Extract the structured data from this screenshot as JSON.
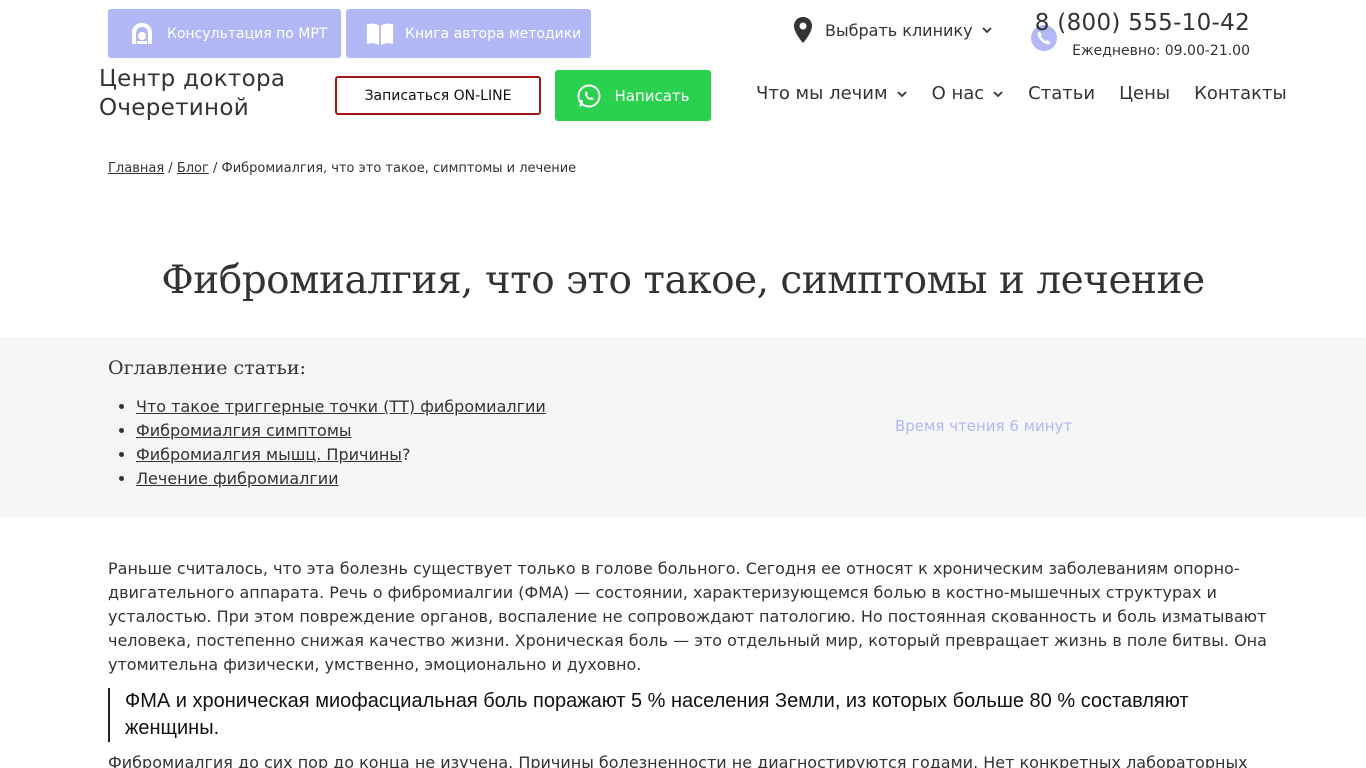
{
  "topbar": {
    "mri_label": "Консультация по МРТ",
    "book_label": "Книга автора методики",
    "clinic_label": "Выбрать клинику",
    "phone": "8 (800) 555-10-42",
    "hours": "Ежедневно: 09.00-21.00"
  },
  "header": {
    "logo_line1": "Центр доктора",
    "logo_line2": "Очеретиной",
    "online_label": "Записаться ON-LINE",
    "write_label": "Написать"
  },
  "nav": {
    "items": [
      "Что мы лечим",
      "О нас",
      "Статьи",
      "Цены",
      "Контакты"
    ]
  },
  "breadcrumb": {
    "home": "Главная",
    "blog": "Блог",
    "current": "Фибромиалгия, что это такое, симптомы и лечение",
    "sep": "/"
  },
  "article": {
    "title": "Фибромиалгия, что это такое, симптомы и лечение",
    "toc_title": "Оглавление статьи:",
    "toc": [
      "Что такое триггерные точки (ТТ) фибромиалгии",
      "Фибромиалгия симптомы",
      "Фибромиалгия мышц. Причины",
      "Лечение фибромиалгии"
    ],
    "toc_suffix": "?",
    "read_time": "Время чтения 6 минут",
    "paragraph1": "Раньше считалось, что эта болезнь существует только в голове больного. Сегодня ее относят к хроническим заболеваниям опорно-двигательного аппарата. Речь о фибромиалгии (ФМА) — состоянии, характеризующемся болью в костно-мышечных структурах и усталостью. При этом повреждение органов, воспаление не сопровождают патологию. Но постоянная скованность и боль изматывают человека, постепенно снижая качество жизни. Хроническая боль — это отдельный мир, который превращает жизнь в поле битвы. Она утомительна физически, умственно, эмоционально и духовно.",
    "quote": "ФМА и хроническая миофасциальная боль поражают 5 % населения Земли, из которых больше 80 % составляют женщины.",
    "paragraph2": "Фибромиалгия до сих пор до конца не изучена. Причины болезненности не диагностируются годами. Нет конкретных лабораторных"
  },
  "colors": {
    "accent_lavender": "#b2b7f5",
    "whatsapp_green": "#29d14f",
    "online_border": "#a01818"
  }
}
